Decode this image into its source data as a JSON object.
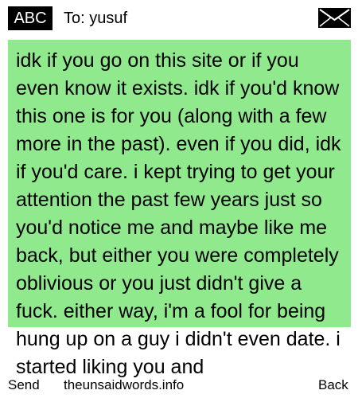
{
  "header": {
    "input_mode": "ABC",
    "to_label": "To:",
    "recipient": "yusuf",
    "envelope_icon": "envelope-icon"
  },
  "message": {
    "body": "idk if you go on this site or if you even know it exists. idk if you'd know this one is for you (along with a few more in the past). even if you did, idk if you'd care. i kept trying to get your attention the past few years just so you'd notice me and maybe like me back, but either you were completely oblivious or you just didn't give a fuck. either way, i'm a fool for being hung up on a guy i didn't even date. i started liking you and",
    "highlight_color": "#90ea8d"
  },
  "footer": {
    "left_softkey": "Send",
    "center_text": "theunsaidwords.info",
    "right_softkey": "Back"
  }
}
